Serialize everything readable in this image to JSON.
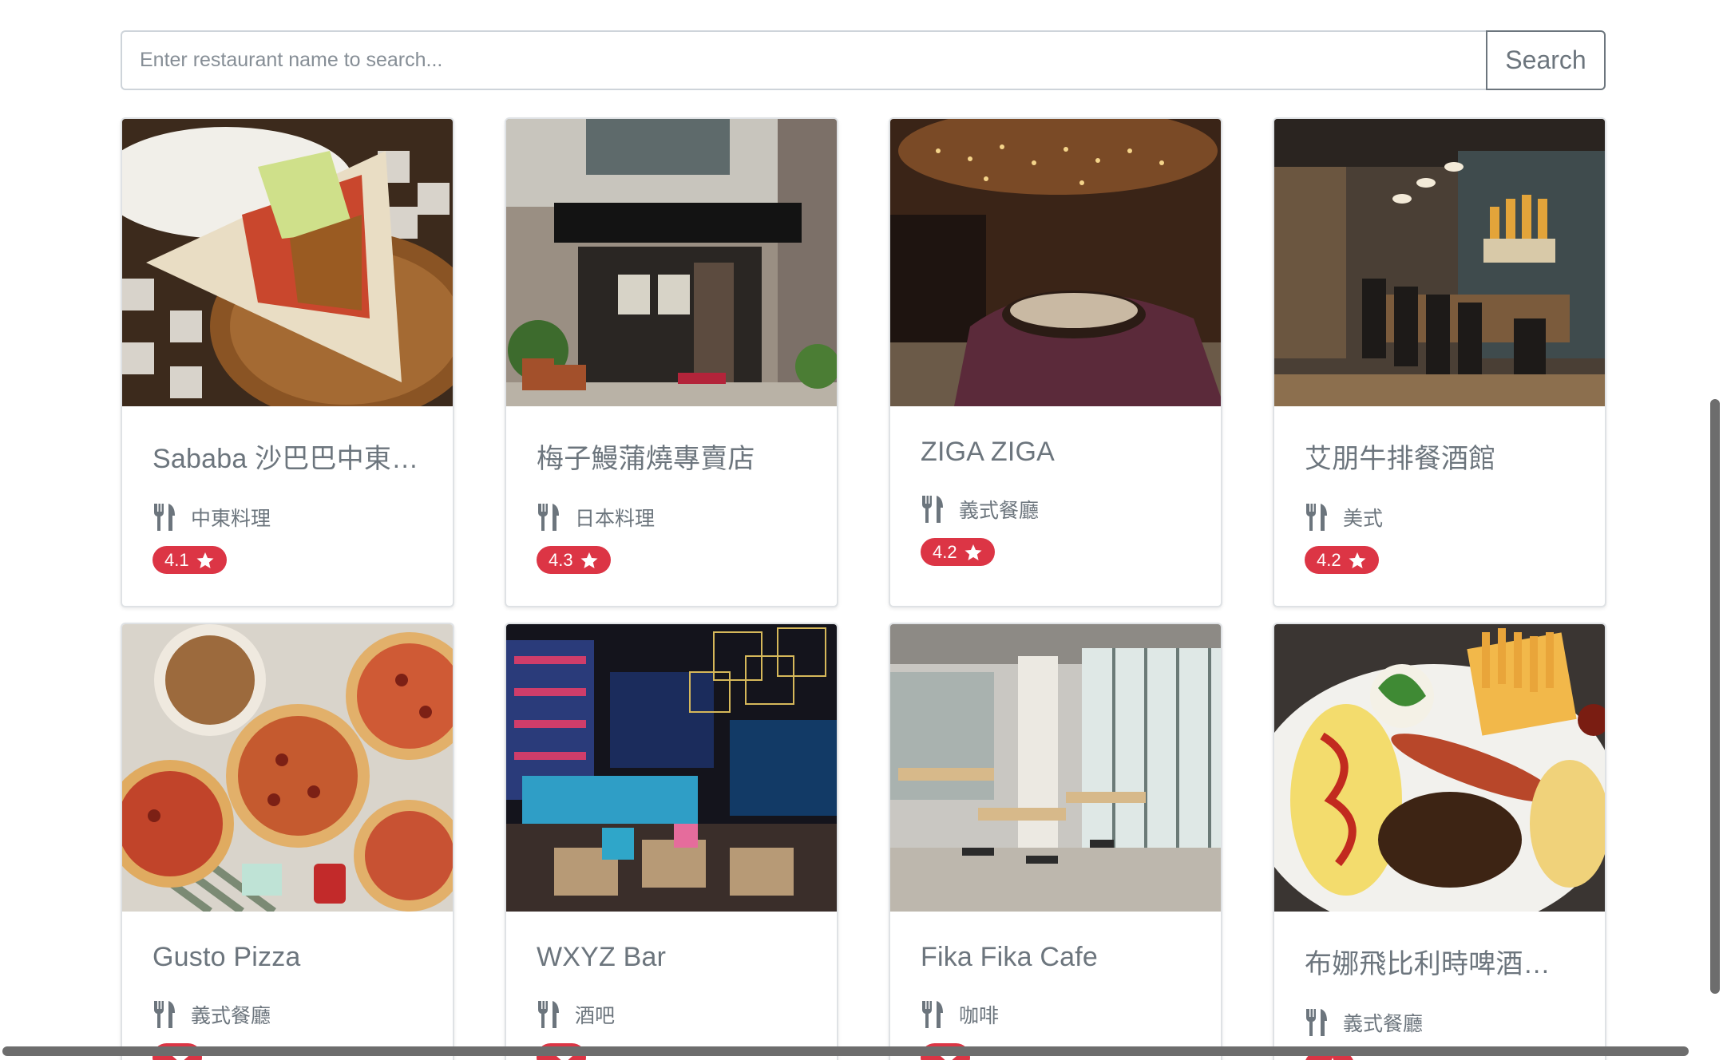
{
  "search": {
    "placeholder": "Enter restaurant name to search...",
    "value": "",
    "button_label": "Search"
  },
  "icons": {
    "category": "utensils-icon",
    "rating": "star-icon"
  },
  "colors": {
    "badge": "#dc3545",
    "text": "#6c757d",
    "border": "#dfe2e5"
  },
  "restaurants": [
    {
      "name": "Sababa 沙巴巴中東美...",
      "category": "中東料理",
      "rating": "4.1"
    },
    {
      "name": "梅子鰻蒲燒專賣店",
      "category": "日本料理",
      "rating": "4.3"
    },
    {
      "name": "ZIGA ZIGA",
      "category": "義式餐廳",
      "rating": "4.2"
    },
    {
      "name": "艾朋牛排餐酒館",
      "category": "美式",
      "rating": "4.2"
    },
    {
      "name": "Gusto Pizza",
      "category": "義式餐廳",
      "rating": ""
    },
    {
      "name": "WXYZ Bar",
      "category": "酒吧",
      "rating": ""
    },
    {
      "name": "Fika Fika Cafe",
      "category": "咖啡",
      "rating": ""
    },
    {
      "name": "布娜飛比利時啤酒餐廳",
      "category": "義式餐廳",
      "rating": ""
    }
  ]
}
